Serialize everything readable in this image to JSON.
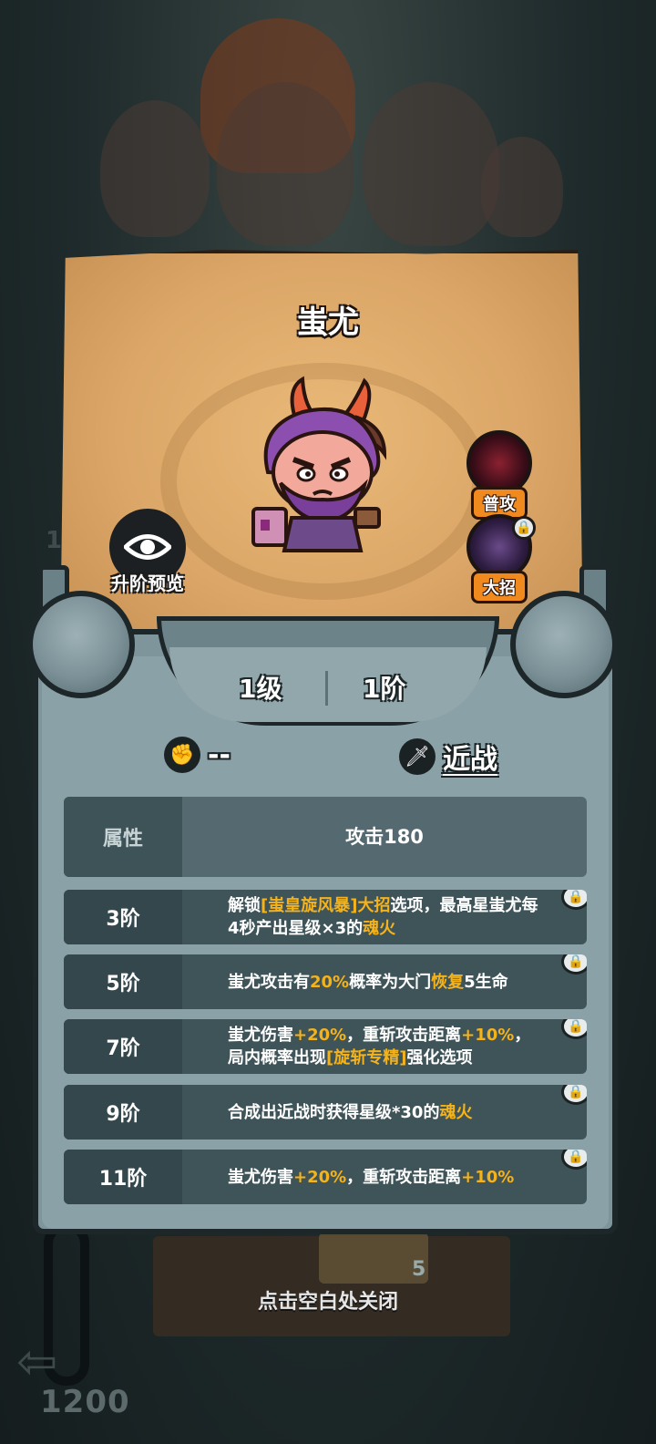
{
  "hero": {
    "name": "蚩尤",
    "preview_label": "升阶预览",
    "skills": [
      {
        "label": "普攻",
        "locked": false
      },
      {
        "label": "大招",
        "locked": true
      }
    ],
    "level": "1级",
    "rank": "1阶",
    "damage_type": "--",
    "range_type": "近战"
  },
  "attributes": {
    "header_label": "属性",
    "header_value": "攻击180",
    "rows": [
      {
        "rank": "3阶",
        "segments": [
          {
            "text": "解锁",
            "hl": false
          },
          {
            "text": "[蚩皇旋风暴]大招",
            "hl": true
          },
          {
            "text": "选项，最高星蚩尤每4秒产出星级×3的",
            "hl": false
          },
          {
            "text": "魂火",
            "hl": true
          }
        ],
        "locked": true
      },
      {
        "rank": "5阶",
        "segments": [
          {
            "text": "蚩尤攻击有",
            "hl": false
          },
          {
            "text": "20%",
            "hl": true
          },
          {
            "text": "概率为大门",
            "hl": false
          },
          {
            "text": "恢复",
            "hl": true
          },
          {
            "text": "5生命",
            "hl": false
          }
        ],
        "locked": true
      },
      {
        "rank": "7阶",
        "segments": [
          {
            "text": "蚩尤伤害",
            "hl": false
          },
          {
            "text": "+20%",
            "hl": true
          },
          {
            "text": "，重斩攻击距离",
            "hl": false
          },
          {
            "text": "+10%",
            "hl": true
          },
          {
            "text": "，局内概率出现",
            "hl": false
          },
          {
            "text": "[旋斩专精]",
            "hl": true
          },
          {
            "text": "强化选项",
            "hl": false
          }
        ],
        "locked": true
      },
      {
        "rank": "9阶",
        "segments": [
          {
            "text": "合成出近战时获得星级*30的",
            "hl": false
          },
          {
            "text": "魂火",
            "hl": true
          }
        ],
        "locked": true
      },
      {
        "rank": "11阶",
        "segments": [
          {
            "text": "蚩尤伤害",
            "hl": false
          },
          {
            "text": "+20%",
            "hl": true
          },
          {
            "text": "，重斩攻击距离",
            "hl": false
          },
          {
            "text": "+10%",
            "hl": true
          }
        ],
        "locked": true
      }
    ]
  },
  "close_hint": "点击空白处关闭",
  "background": {
    "coins": "1200",
    "card_count": "5",
    "side_number": "1"
  },
  "colors": {
    "highlight": "#f4b21b",
    "skill_tag": "#f08a1e",
    "table_row": "#3f5459",
    "stone": "#7e959b"
  }
}
